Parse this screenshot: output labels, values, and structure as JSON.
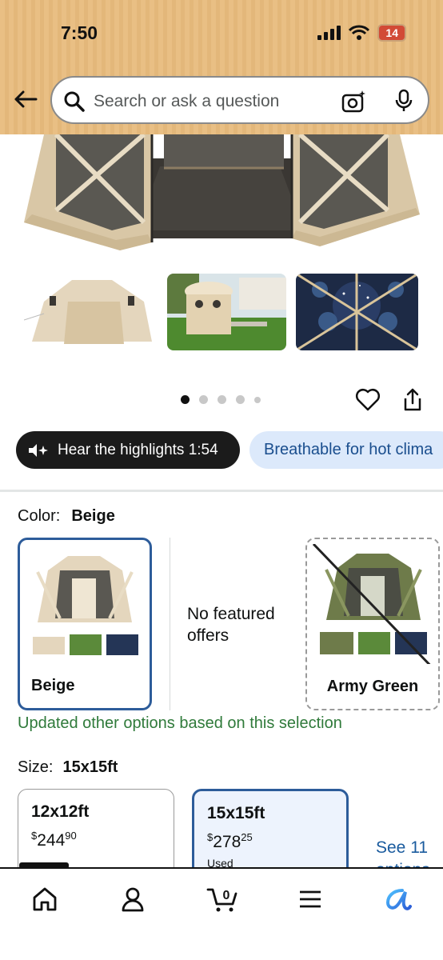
{
  "status_bar": {
    "time": "7:50",
    "battery": "14"
  },
  "search": {
    "placeholder": "Search or ask a question"
  },
  "highlights": {
    "hear_label": "Hear the highlights 1:54",
    "chip_label": "Breathable for hot clima"
  },
  "carousel": {
    "total": 5,
    "active": 1
  },
  "color": {
    "label": "Color:",
    "selected": "Beige",
    "options": [
      {
        "name": "Beige"
      },
      {
        "name": "Army Green"
      }
    ],
    "no_offers": "No featured offers",
    "updated_note": "Updated other options based on this selection"
  },
  "size": {
    "label": "Size:",
    "selected": "15x15ft",
    "options": [
      {
        "name": "12x12ft",
        "price_symbol": "$",
        "price_whole": "244",
        "price_fraction": "90",
        "note": ""
      },
      {
        "name": "15x15ft",
        "price_symbol": "$",
        "price_whole": "278",
        "price_fraction": "25",
        "note": "Used"
      }
    ],
    "see_more": "See 11",
    "see_more_2": "options"
  },
  "nav": {
    "items": [
      "home-icon",
      "account-icon",
      "cart-icon",
      "menu-icon",
      "rufus-icon"
    ],
    "cart_count": "0"
  },
  "colors": {
    "header": "#e9bf84",
    "accent_blue": "#2d5c9a",
    "link": "#1a5b9e",
    "success": "#2f7a3a"
  }
}
